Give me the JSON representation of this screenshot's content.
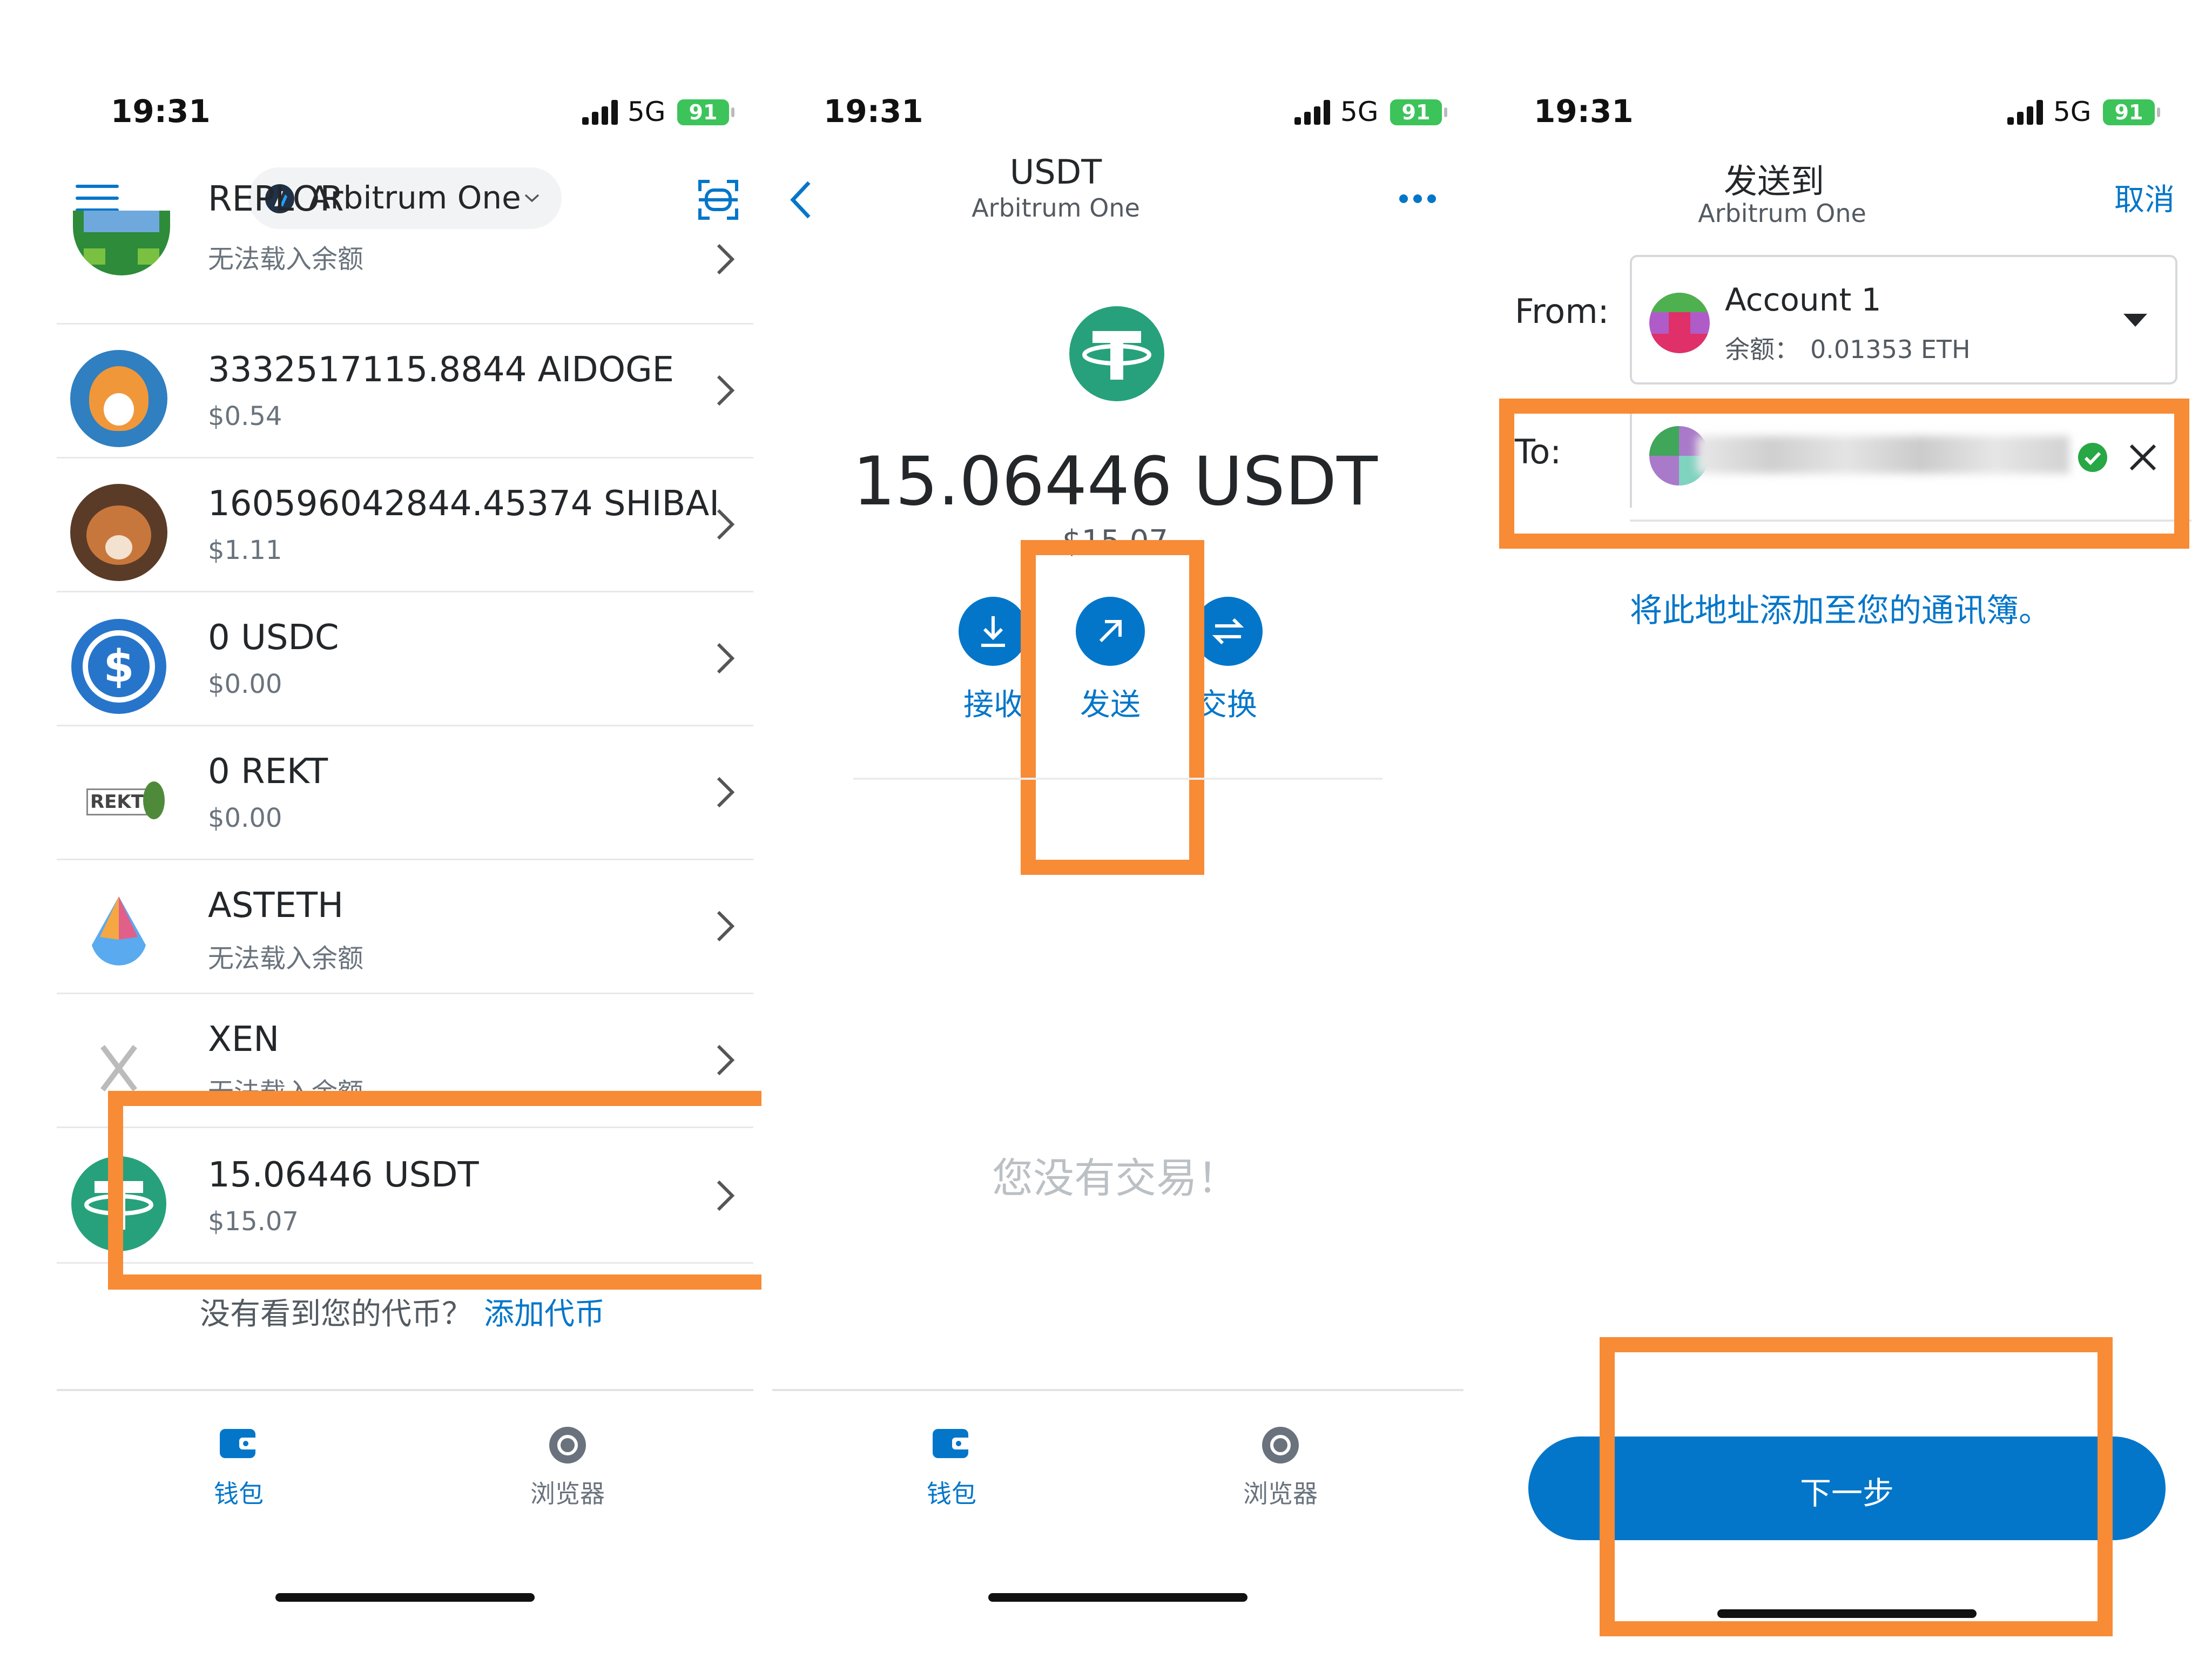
{
  "status_bar": {
    "time": "19:31",
    "network": "5G",
    "battery": "91"
  },
  "screen1": {
    "network_selector": "Arbitrum One",
    "tokens": [
      {
        "title": "REPLOR",
        "subtitle": "无法载入余额",
        "icon": "replor-pixel-icon"
      },
      {
        "title": "3332517115.8844 AIDOGE",
        "subtitle": "$0.54",
        "icon": "aidoge-icon"
      },
      {
        "title": "160596042844.45374 SHIBAI",
        "subtitle": "$1.11",
        "icon": "shibai-icon"
      },
      {
        "title": "0 USDC",
        "subtitle": "$0.00",
        "icon": "usdc-icon"
      },
      {
        "title": "0 REKT",
        "subtitle": "$0.00",
        "icon": "rekt-icon",
        "icon_text": "REKT"
      },
      {
        "title": "ASTETH",
        "subtitle": "无法载入余额",
        "icon": "asteth-drop-icon"
      },
      {
        "title": "XEN",
        "subtitle": "无法载入余额",
        "icon": "xen-icon"
      },
      {
        "title": "15.06446 USDT",
        "subtitle": "$15.07",
        "icon": "tether-icon"
      }
    ],
    "footer_question": "没有看到您的代币？",
    "footer_link": "添加代币",
    "tabs": {
      "wallet": "钱包",
      "browser": "浏览器"
    }
  },
  "screen2": {
    "title": "USDT",
    "subtitle": "Arbitrum One",
    "balance": "15.06446 USDT",
    "fiat": "$15.07",
    "actions": {
      "receive": "接收",
      "send": "发送",
      "swap": "交换"
    },
    "empty_text": "您没有交易！",
    "tabs": {
      "wallet": "钱包",
      "browser": "浏览器"
    }
  },
  "screen3": {
    "title": "发送到",
    "subtitle": "Arbitrum One",
    "cancel": "取消",
    "from_label": "From:",
    "account_name": "Account 1",
    "balance_label": "余额：",
    "balance_value": "0.01353 ETH",
    "to_label": "To:",
    "add_contact": "将此地址添加至您的通讯簿。",
    "next": "下一步"
  },
  "colors": {
    "accent": "#0376c9",
    "highlight": "#f78b36",
    "tether": "#26a17b",
    "battery": "#3cc35a"
  }
}
